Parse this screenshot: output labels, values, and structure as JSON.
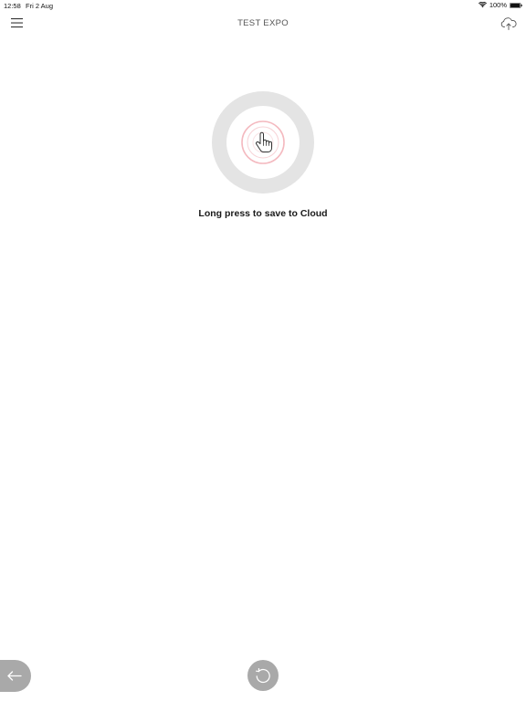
{
  "status_bar": {
    "time": "12:58",
    "date": "Fri 2 Aug",
    "battery_text": "100%"
  },
  "nav": {
    "title": "TEST EXPO",
    "menu_icon": "hamburger-menu-icon",
    "cloud_icon": "cloud-upload-icon"
  },
  "main": {
    "press_icon": "hand-pointer-icon",
    "press_label": "Long press to save to Cloud"
  },
  "bottom": {
    "back_icon": "arrow-left-icon",
    "refresh_icon": "refresh-icon"
  },
  "colors": {
    "accent_ring": "#f4b9bf",
    "outer_ring": "#e4e4e4",
    "button_gray": "#a9a9a9"
  }
}
